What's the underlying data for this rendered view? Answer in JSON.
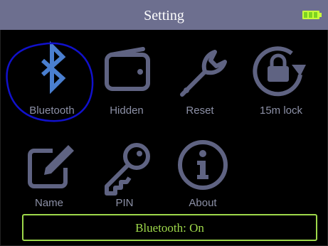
{
  "header": {
    "title": "Setting",
    "battery_icon": "battery-full-icon"
  },
  "colors": {
    "icon": "#5f6382",
    "label": "#8c90a6",
    "accent": "#9ed84a",
    "titlebar": "#6d6f8f",
    "highlight": "#3a7bd5"
  },
  "menu": {
    "items": [
      {
        "label": "Bluetooth",
        "icon": "bluetooth-icon"
      },
      {
        "label": "Hidden",
        "icon": "wallet-icon"
      },
      {
        "label": "Reset",
        "icon": "wrench-icon"
      },
      {
        "label": "15m lock",
        "icon": "lock-rotate-icon"
      },
      {
        "label": "Name",
        "icon": "edit-icon"
      },
      {
        "label": "PIN",
        "icon": "key-icon"
      },
      {
        "label": "About",
        "icon": "info-icon"
      }
    ]
  },
  "status": {
    "text": "Bluetooth: On"
  }
}
